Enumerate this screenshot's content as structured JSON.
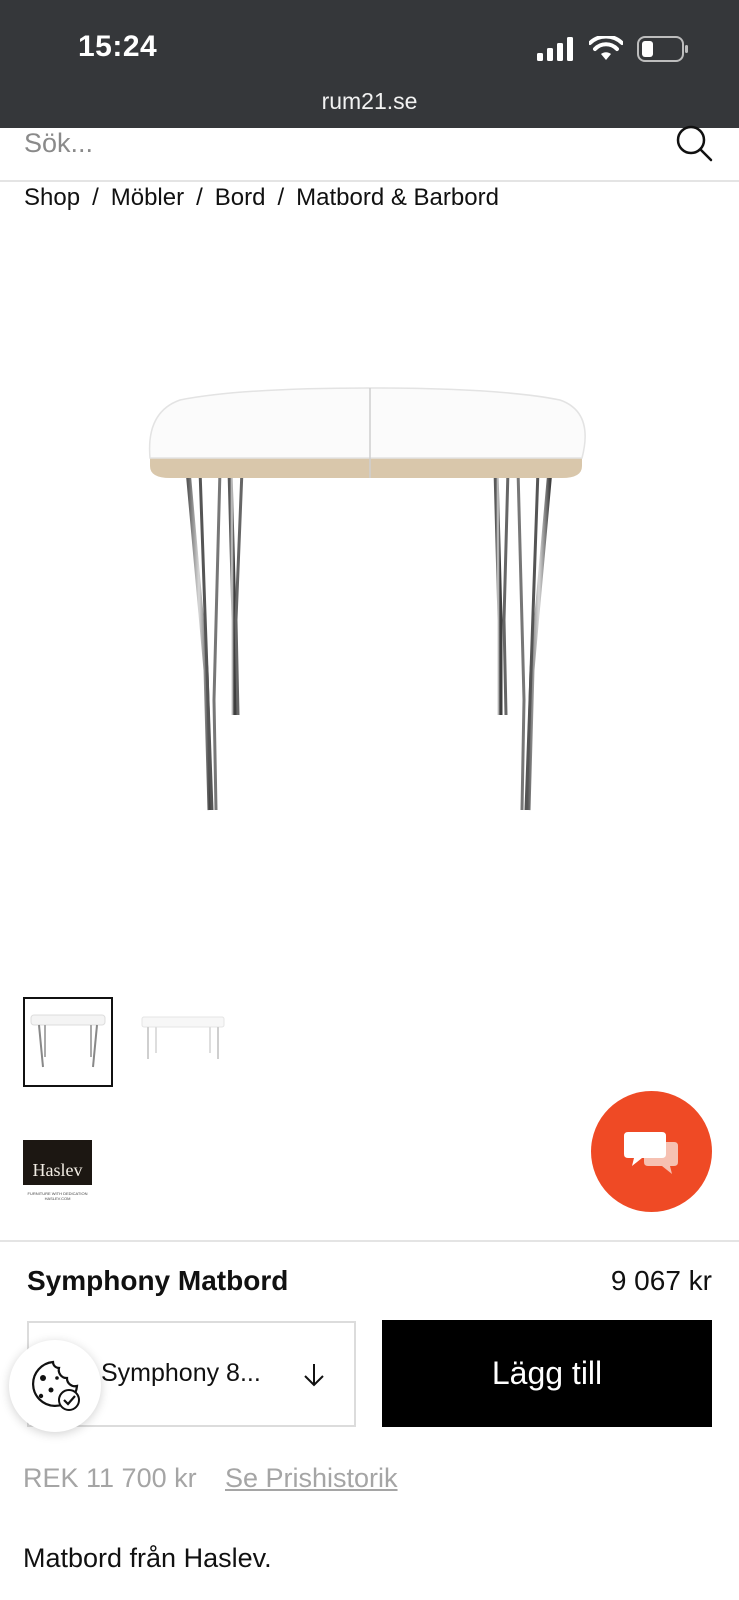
{
  "status_bar": {
    "time": "15:24",
    "url": "rum21.se"
  },
  "search": {
    "placeholder": "Sök..."
  },
  "breadcrumb": {
    "items": [
      "Shop",
      "Möbler",
      "Bord",
      "Matbord & Barbord"
    ],
    "separator": "/"
  },
  "gallery": {
    "brand_logo_name": "Haslev",
    "brand_logo_tagline": "FURNITURE WITH DEDICATION HASLEV.COM"
  },
  "product": {
    "title": "Symphony Matbord",
    "price": "9 067 kr",
    "variant_selected": "Symphony 8...",
    "add_button_label": "Lägg till",
    "ref_price": "REK 11 700 kr",
    "price_history_link": "Se Prishistorik",
    "description": "Matbord från Haslev."
  },
  "colors": {
    "status_bar_bg": "#35373a",
    "chat_button": "#ef4a25",
    "add_button_bg": "#000000"
  },
  "icons": [
    "signal-icon",
    "wifi-icon",
    "battery-icon",
    "search-icon",
    "chat-icon",
    "arrow-down-icon",
    "cookie-icon"
  ]
}
